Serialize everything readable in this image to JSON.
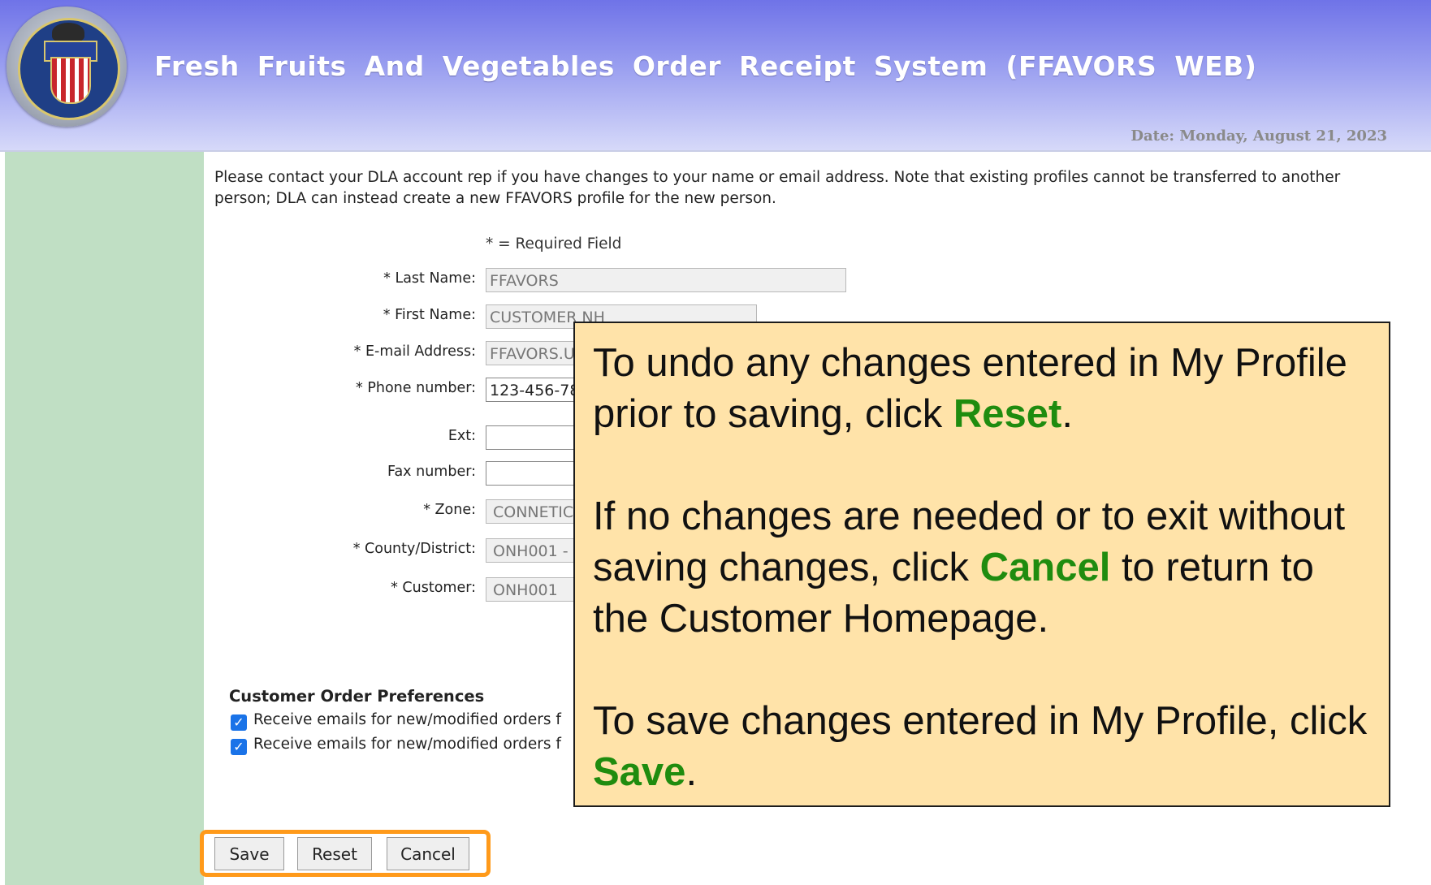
{
  "header": {
    "app_title": "Fresh Fruits And Vegetables Order Receipt System (FFAVORS WEB)",
    "date": "Date: Monday, August 21, 2023"
  },
  "notice": "Please contact your DLA account rep if you have changes to your name or email address. Note that existing profiles cannot be transferred to another person; DLA can instead create a new FFAVORS profile for the new person.",
  "form": {
    "required_note": "* = Required Field",
    "fields": [
      {
        "label": "* Last Name:",
        "value": "FFAVORS"
      },
      {
        "label": "* First Name:",
        "value": "CUSTOMER NH"
      },
      {
        "label": "* E-mail Address:",
        "value": "FFAVORS.U"
      },
      {
        "label": "* Phone number:",
        "value": "123-456-78"
      },
      {
        "label": "Ext:",
        "value": ""
      },
      {
        "label": "Fax number:",
        "value": ""
      },
      {
        "label": "* Zone:",
        "value": "CONNETIC"
      },
      {
        "label": "* County/District:",
        "value": "ONH001 -"
      },
      {
        "label": "* Customer:",
        "value": "ONH001"
      }
    ]
  },
  "preferences": {
    "title": "Customer Order Preferences",
    "items": [
      {
        "label": "Receive emails for new/modified orders f",
        "checked": true
      },
      {
        "label": "Receive emails for new/modified orders f",
        "checked": true
      }
    ]
  },
  "buttons": {
    "save": "Save",
    "reset": "Reset",
    "cancel": "Cancel"
  },
  "callout": {
    "p1_a": "To undo any changes entered in My Profile prior to saving, click ",
    "p1_kw": "Reset",
    "p1_b": ".",
    "p2_a": "If no changes are needed or to exit without saving changes, click ",
    "p2_kw": "Cancel",
    "p2_b": " to return to the Customer Homepage.",
    "p3_a": "To save changes entered in My Profile, click ",
    "p3_kw": "Save",
    "p3_b": ".",
    "highlight_color": "#1f8c0f",
    "background_color": "#ffe3a9"
  },
  "colors": {
    "header_gradient_top": "#6f73e8",
    "sidebar_green": "#c0dfc4",
    "button_highlight_border": "#ff9a1a"
  }
}
